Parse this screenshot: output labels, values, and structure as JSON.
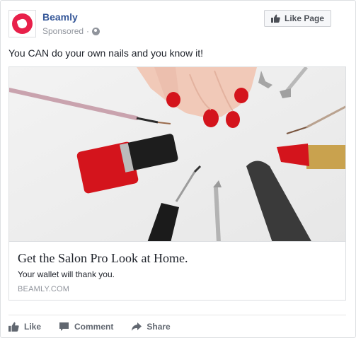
{
  "page": {
    "name": "Beamly",
    "sponsored_label": "Sponsored",
    "separator": "·",
    "brand_color": "#e8204a",
    "link_color": "#365899"
  },
  "header": {
    "like_page_label": "Like Page",
    "like_page_icon": "thumbs-up-icon"
  },
  "post": {
    "text": "You CAN do your own nails and you know it!"
  },
  "link": {
    "headline": "Get the Salon Pro Look at Home.",
    "description": "Your wallet will thank you.",
    "domain": "BEAMLY.COM"
  },
  "actions": [
    {
      "label": "Like",
      "icon": "thumbs-up-icon"
    },
    {
      "label": "Comment",
      "icon": "comment-icon"
    },
    {
      "label": "Share",
      "icon": "share-arrow-icon"
    }
  ]
}
